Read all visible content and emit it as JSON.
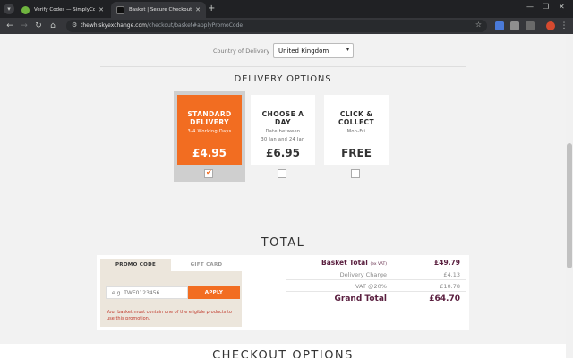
{
  "browser": {
    "tabs": [
      {
        "title": "Verify Codes — SimplyCodes"
      },
      {
        "title": "Basket | Secure Checkout : The W"
      }
    ],
    "new_tab": "+",
    "url_host": "thewhiskyexchange.com",
    "url_path": "/checkout/basket#applyPromoCode"
  },
  "delivery": {
    "country_label": "Country of Delivery",
    "country_value": "United Kingdom",
    "heading": "DELIVERY OPTIONS",
    "options": [
      {
        "title": "STANDARD DELIVERY",
        "subtitle": "3-4 Working Days",
        "price": "£4.95",
        "selected": true
      },
      {
        "title": "CHOOSE A DAY",
        "subtitle": "Date between",
        "subtitle2": "30 Jan and 24 Jan",
        "price": "£6.95",
        "selected": false
      },
      {
        "title": "CLICK & COLLECT",
        "subtitle": "Mon-Fri",
        "price": "FREE",
        "selected": false
      }
    ]
  },
  "total": {
    "heading": "TOTAL",
    "promo_tab": "PROMO CODE",
    "gift_tab": "GIFT CARD",
    "promo_placeholder": "e.g. TWE0123456",
    "apply_label": "APPLY",
    "promo_message": "Your basket must contain one of the eligible products to use this promotion.",
    "rows": {
      "basket_label": "Basket Total",
      "basket_note": "(ex VAT)",
      "basket_value": "£49.79",
      "delivery_label": "Delivery Charge",
      "delivery_value": "£4.13",
      "vat_label": "VAT @20%",
      "vat_value": "£10.78",
      "grand_label": "Grand Total",
      "grand_value": "£64.70"
    }
  },
  "checkout": {
    "heading": "CHECKOUT OPTIONS"
  },
  "colors": {
    "accent_orange": "#f26d21",
    "brand_plum": "#5a1f3f"
  }
}
